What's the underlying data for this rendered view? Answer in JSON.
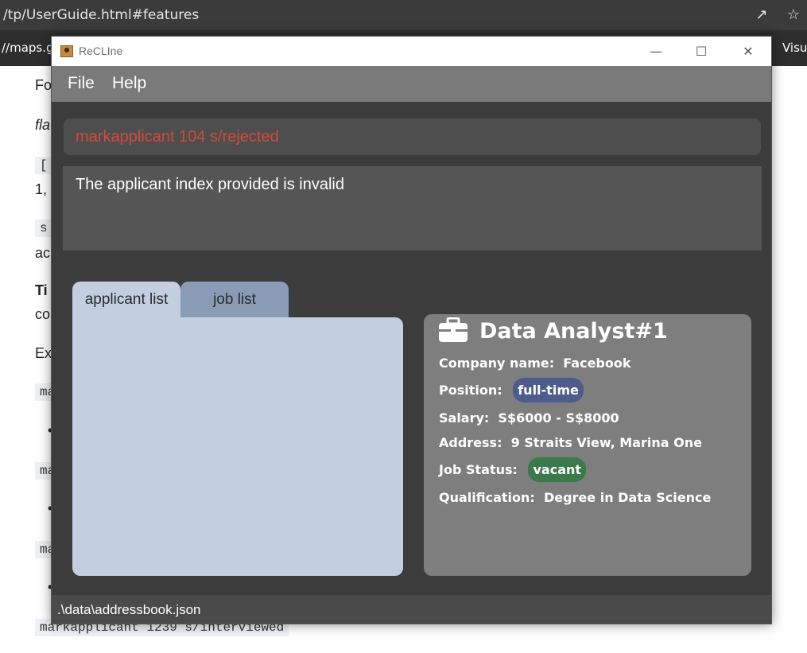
{
  "browser": {
    "url": "/tp/UserGuide.html#features",
    "share_icon": "share-icon",
    "star_icon": "star-icon",
    "bookmark_left": "//maps.go",
    "bookmark_right": "Visu"
  },
  "doc": {
    "frag_fo": "Fo",
    "frag_fla": "fla",
    "code_bracket": "[",
    "frag_1": "1,",
    "code_s": "s",
    "frag_ac": "ac",
    "frag_ti": "Ti",
    "frag_co": "co",
    "frag_ex": "Ex",
    "code_ma": "ma",
    "code_last": "markapplicant 1239 s/interviewed",
    "bullet": "•"
  },
  "window": {
    "title": "ReCLIne",
    "minimize": "—",
    "maximize": "☐",
    "close": "✕"
  },
  "menu": {
    "file": "File",
    "help": "Help"
  },
  "command": {
    "value": "markapplicant 104 s/rejected"
  },
  "result": {
    "text": "The applicant index provided is invalid"
  },
  "tabs": {
    "applicant_list": "applicant list",
    "job_list": "job list"
  },
  "job_card": {
    "icon": "briefcase-icon",
    "title": "Data Analyst#1",
    "company_label": "Company name:",
    "company_value": "Facebook",
    "position_label": "Position:",
    "position_value": "full-time",
    "salary_label": "Salary:",
    "salary_value": "S$6000 - S$8000",
    "address_label": "Address:",
    "address_value": "9 Straits View, Marina One",
    "status_label": "Job Status:",
    "status_value": "vacant",
    "qualification_label": "Qualification:",
    "qualification_value": "Degree in Data Science"
  },
  "status": {
    "path": ".\\data\\addressbook.json"
  },
  "colors": {
    "command_error": "#d24a3a",
    "position_pill": "#4d5c8a",
    "status_pill": "#3a7a4a"
  }
}
